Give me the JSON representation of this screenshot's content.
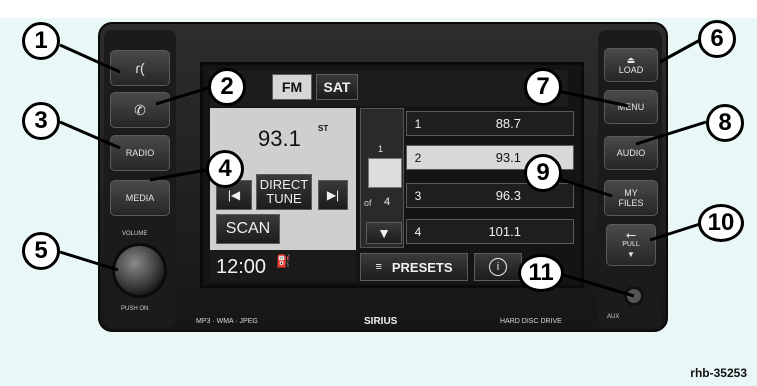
{
  "callouts": [
    "1",
    "2",
    "3",
    "4",
    "5",
    "6",
    "7",
    "8",
    "9",
    "10",
    "11"
  ],
  "left_buttons": {
    "radio": "RADIO",
    "media": "MEDIA",
    "volume": "VOLUME",
    "push_on": "PUSH ON"
  },
  "right_buttons": {
    "load": "LOAD",
    "menu": "MENU",
    "audio": "AUDIO",
    "my_files": "MY FILES",
    "pull": "PULL",
    "aux": "AUX"
  },
  "screen": {
    "tabs": [
      "FM",
      "SAT"
    ],
    "station": "93.1",
    "stereo": "ST",
    "direct_tune": "DIRECT TUNE",
    "scan": "SCAN",
    "clock": "12:00",
    "page_current": "1",
    "page_of": "of",
    "page_total": "4",
    "presets_label": "PRESETS",
    "info_glyph": "i",
    "presets": [
      {
        "num": "1",
        "freq": "88.7"
      },
      {
        "num": "2",
        "freq": "93.1"
      },
      {
        "num": "3",
        "freq": "96.3"
      },
      {
        "num": "4",
        "freq": "101.1"
      }
    ]
  },
  "bottom_strip": {
    "formats": "MP3 · WMA · JPEG",
    "brand": "SIRIUS",
    "hdd": "HARD DISC DRIVE",
    "aux": "AUX"
  },
  "figure_ref": "rhb-35253"
}
